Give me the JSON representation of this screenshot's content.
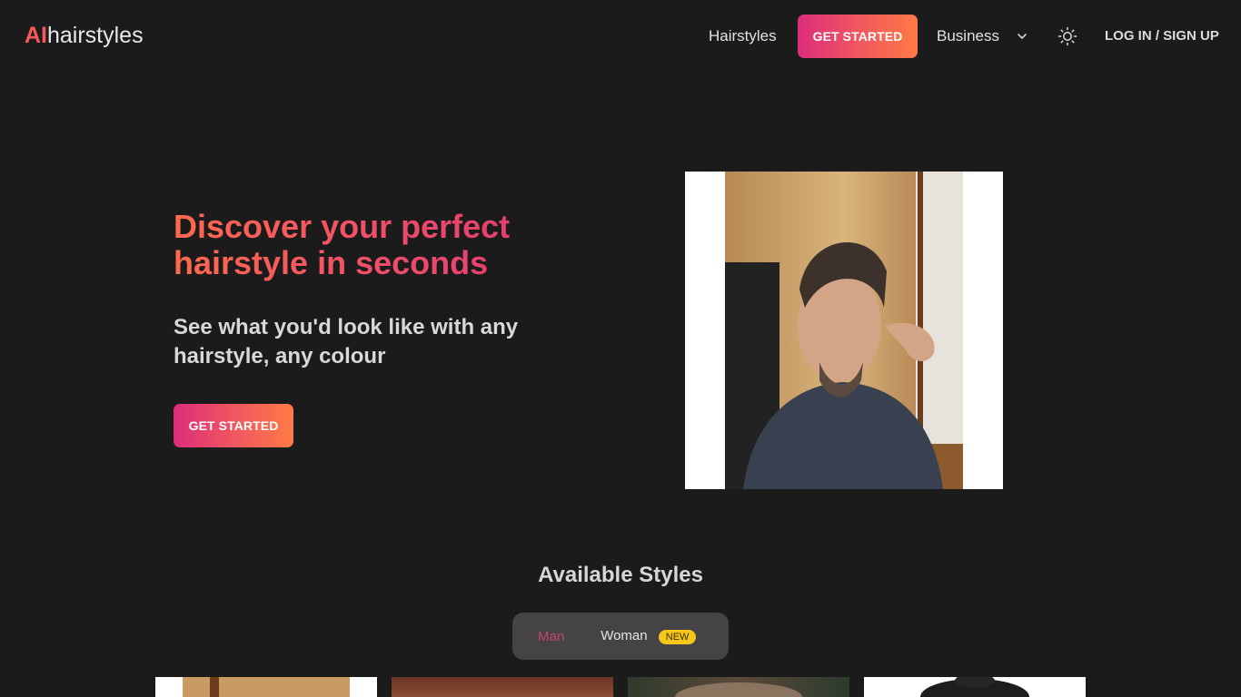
{
  "brand": {
    "ai": "AI",
    "rest": "hairstyles"
  },
  "nav": {
    "hairstyles": "Hairstyles",
    "get_started": "GET STARTED",
    "business": "Business",
    "login": "LOG IN / SIGN UP"
  },
  "hero": {
    "title": "Discover your perfect hairstyle in seconds",
    "subtitle": "See what you'd look like with any hairstyle, any colour",
    "cta": "GET STARTED"
  },
  "styles": {
    "title": "Available Styles",
    "tabs": [
      {
        "label": "Man",
        "active": true
      },
      {
        "label": "Woman",
        "badge": "NEW"
      }
    ]
  },
  "colors": {
    "background": "#1b1b1c",
    "brand_red": "#f85a5a",
    "gradient_start": "#dc2d7a",
    "gradient_end": "#ff7a45",
    "badge_yellow": "#f6c619"
  },
  "icons": [
    "chevron-down-icon",
    "sun-icon"
  ]
}
